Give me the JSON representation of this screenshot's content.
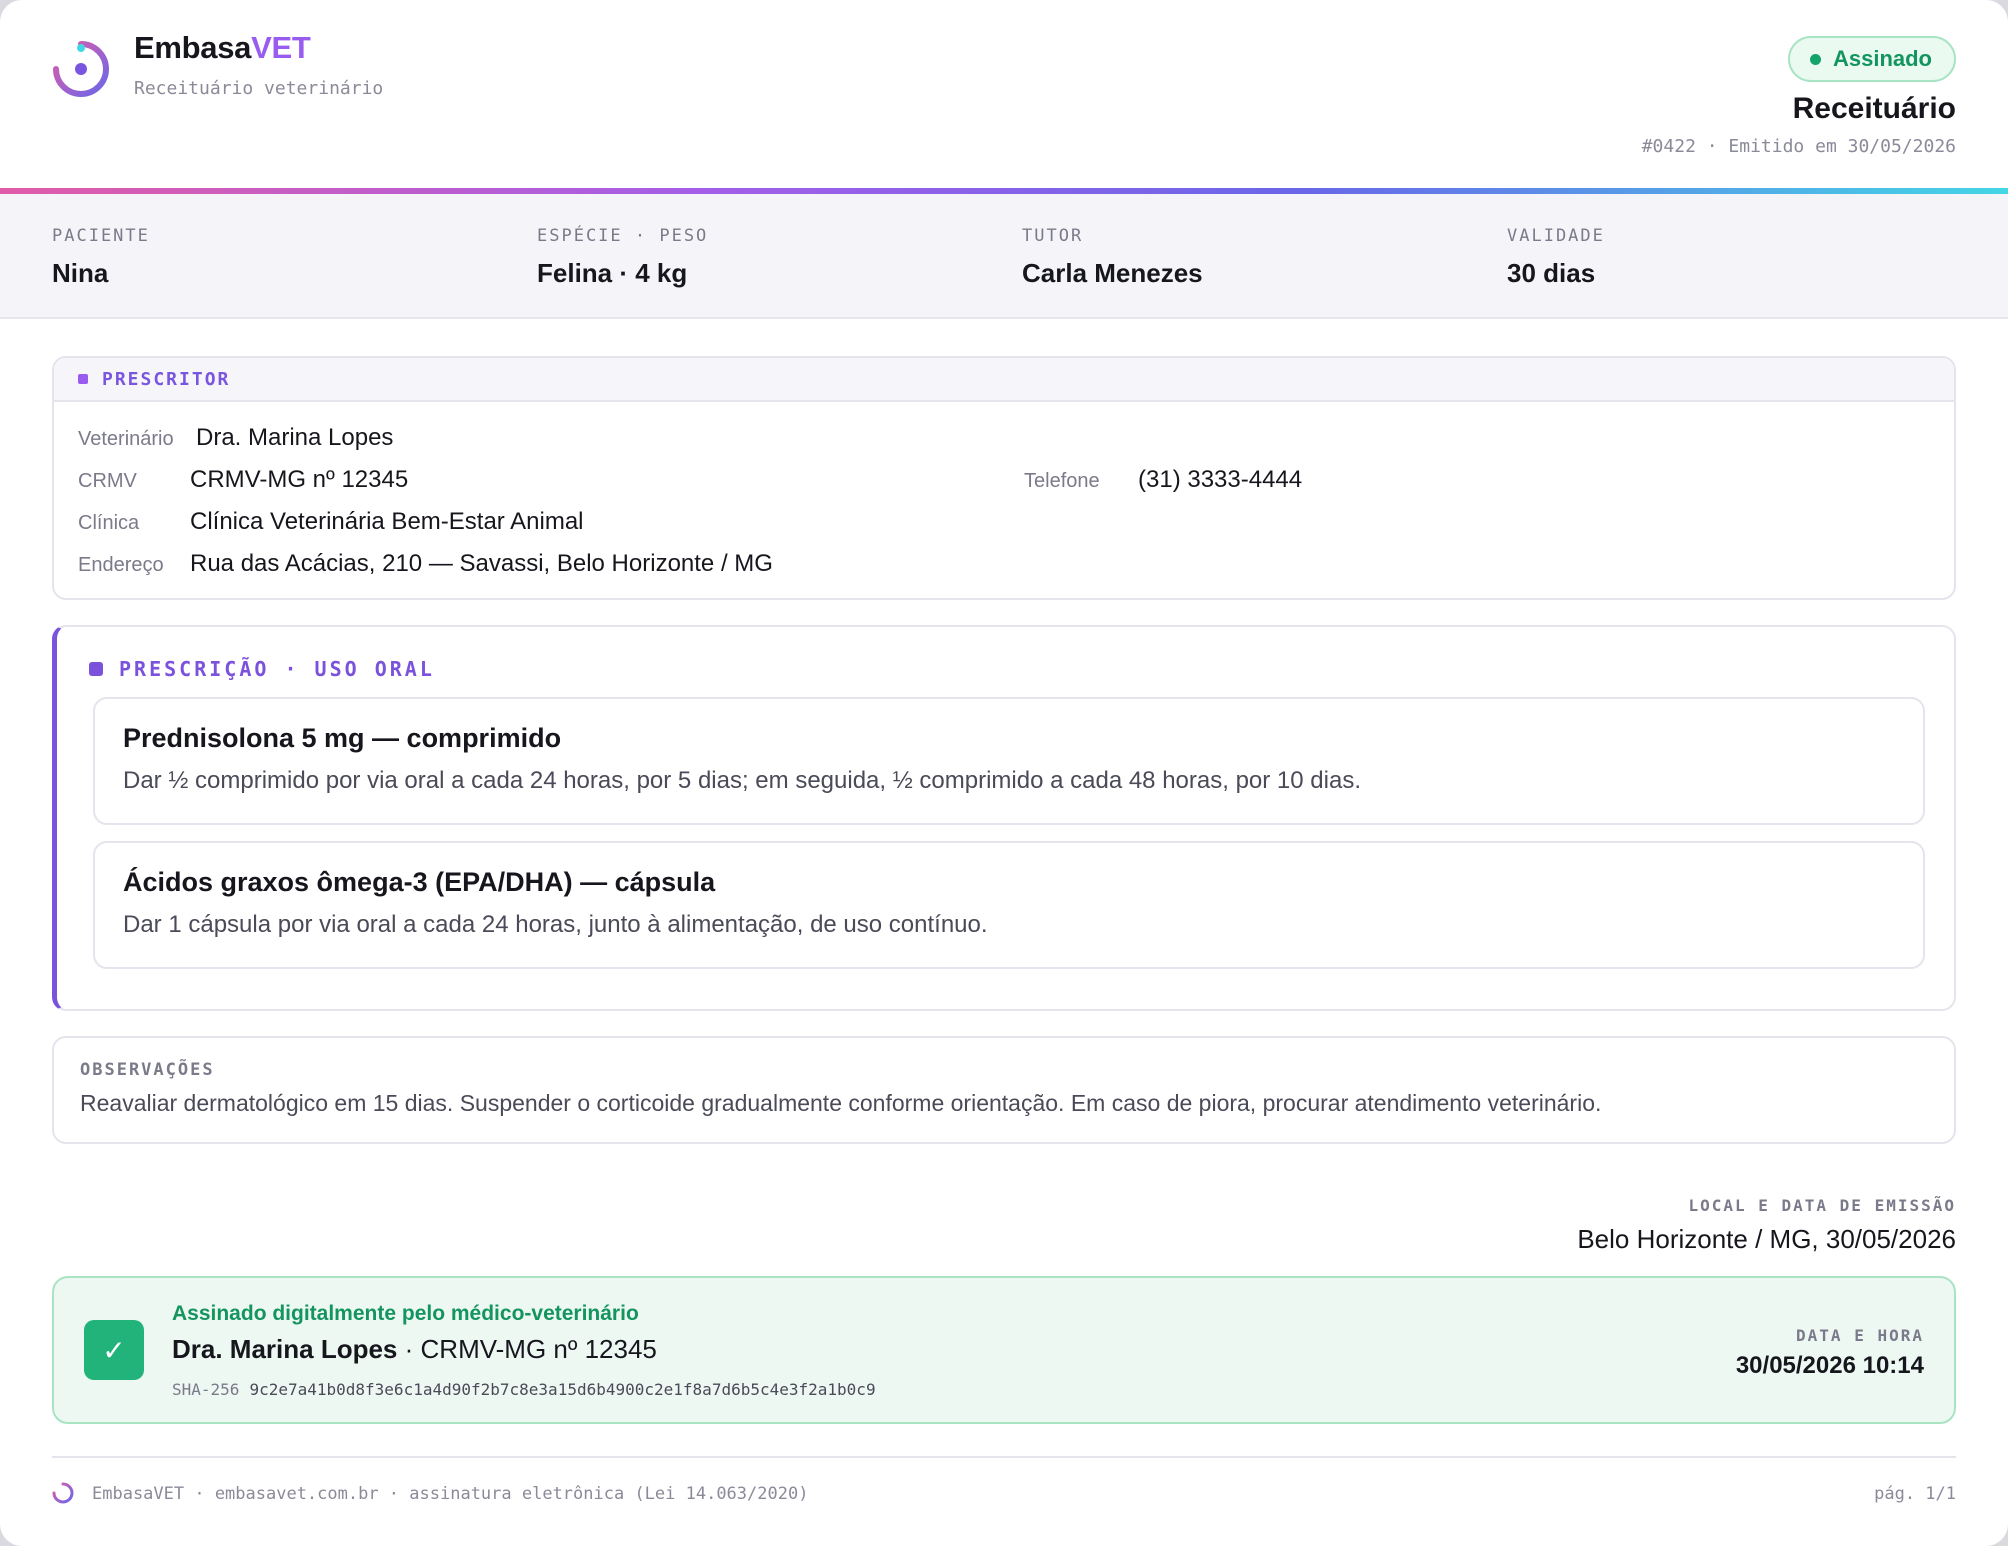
{
  "brand": {
    "name_main": "Embasa",
    "name_accent": "VET",
    "subtitle": "Receituário veterinário"
  },
  "status": {
    "label": "Assinado",
    "color": "#14955e"
  },
  "document": {
    "title": "Receituário",
    "meta": "#0422 · Emitido em 30/05/2026"
  },
  "patient_strip": [
    {
      "label": "PACIENTE",
      "value": "Nina"
    },
    {
      "label": "ESPÉCIE · PESO",
      "value": "Felina · 4 kg"
    },
    {
      "label": "TUTOR",
      "value": "Carla Menezes"
    },
    {
      "label": "VALIDADE",
      "value": "30 dias"
    }
  ],
  "prescriber": {
    "section_label": "PRESCRITOR",
    "vet_label": "Veterinário",
    "vet_value": "Dra. Marina Lopes",
    "crmv_label": "CRMV",
    "crmv_value": "CRMV-MG nº 12345",
    "phone_label": "Telefone",
    "phone_value": "(31) 3333-4444",
    "clinic_label": "Clínica",
    "clinic_value": "Clínica Veterinária Bem-Estar Animal",
    "address_label": "Endereço",
    "address_value": "Rua das Acácias, 210 — Savassi, Belo Horizonte / MG"
  },
  "prescription": {
    "section_label": "PRESCRIÇÃO · USO ORAL",
    "items": [
      {
        "name": "Prednisolona 5 mg — comprimido",
        "instructions": "Dar ½ comprimido por via oral a cada 24 horas, por 5 dias; em seguida, ½ comprimido a cada 48 horas, por 10 dias."
      },
      {
        "name": "Ácidos graxos ômega-3 (EPA/DHA) — cápsula",
        "instructions": "Dar 1 cápsula por via oral a cada 24 horas, junto à alimentação, de uso contínuo."
      }
    ]
  },
  "observations": {
    "label": "OBSERVAÇÕES",
    "text": "Reavaliar dermatológico em 15 dias. Suspender o corticoide gradualmente conforme orientação. Em caso de piora, procurar atendimento veterinário."
  },
  "issue_place": {
    "label": "LOCAL E DATA DE EMISSÃO",
    "value": "Belo Horizonte / MG, 30/05/2026"
  },
  "signature": {
    "check_glyph": "✓",
    "title": "Assinado digitalmente pelo médico-veterinário",
    "signer_name": "Dra. Marina Lopes",
    "signer_crmv": " · CRMV-MG nº 12345",
    "hash_label": "SHA-256",
    "hash_value": "9c2e7a41b0d8f3e6c1a4d90f2b7c8e3a15d6b4900c2e1f8a7d6b5c4e3f2a1b0c9",
    "datetime_label": "DATA E HORA",
    "datetime_value": "30/05/2026 10:14"
  },
  "footer": {
    "text": "EmbasaVET · embasavet.com.br · assinatura eletrônica (Lei 14.063/2020)",
    "page": "pág. 1/1"
  }
}
